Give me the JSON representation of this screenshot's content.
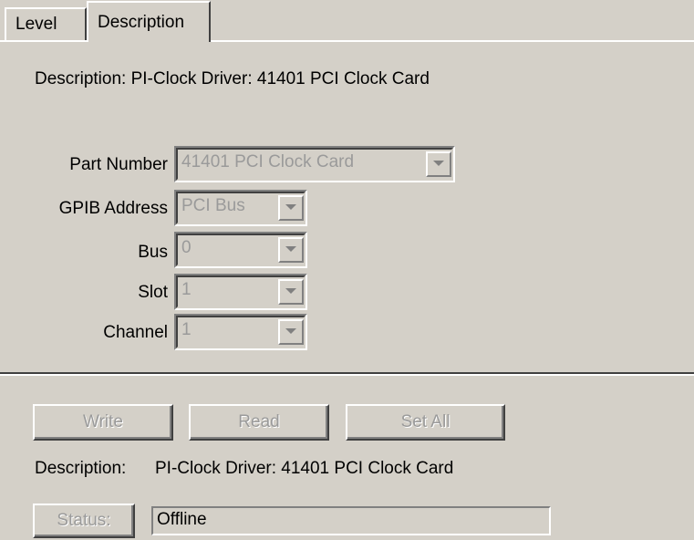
{
  "tabs": [
    {
      "label": "Level",
      "selected": false
    },
    {
      "label": "Description",
      "selected": true
    }
  ],
  "description_panel": {
    "description_text": "Description: PI-Clock Driver: 41401 PCI Clock Card",
    "fields": {
      "part_number": {
        "label": "Part Number",
        "value": "41401 PCI Clock Card"
      },
      "gpib_address": {
        "label": "GPIB Address",
        "value": "PCI Bus"
      },
      "bus": {
        "label": "Bus",
        "value": "0"
      },
      "slot": {
        "label": "Slot",
        "value": "1"
      },
      "channel": {
        "label": "Channel",
        "value": "1"
      }
    }
  },
  "bottom_panel": {
    "buttons": {
      "write": "Write",
      "read": "Read",
      "set_all": "Set All"
    },
    "description_label": "Description:",
    "description_value": "PI-Clock Driver: 41401 PCI Clock Card",
    "status_button": "Status:",
    "status_value": "Offline"
  },
  "icons": {
    "dropdown": "chevron-down-icon"
  },
  "colors": {
    "background": "#d4d0c8",
    "disabled_text": "#9a9a9a"
  }
}
